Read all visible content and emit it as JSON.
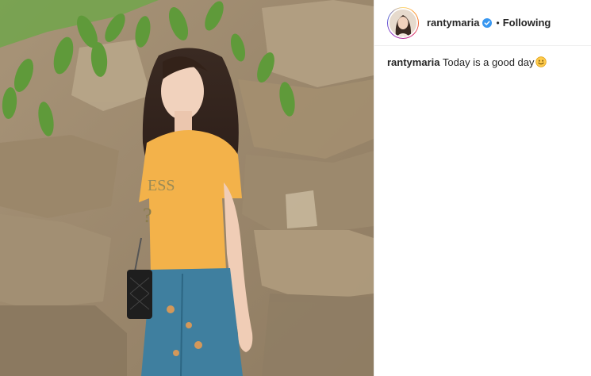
{
  "post": {
    "username": "rantymaria",
    "follow_status": "Following",
    "separator": "•",
    "caption_user": "rantymaria",
    "caption_text": "Today is a good day",
    "caption_emoji": "smiling-face-icon"
  },
  "colors": {
    "verified": "#3897f0",
    "text": "#262626",
    "divider": "#efefef"
  }
}
